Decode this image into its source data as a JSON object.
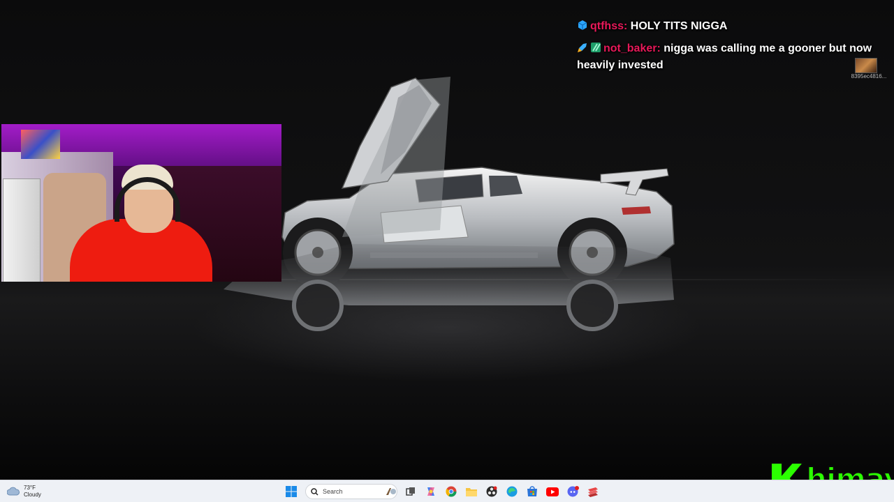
{
  "chat": {
    "messages": [
      {
        "username": "qtfhss:",
        "text": "HOLY TITS NIGGA"
      },
      {
        "username": "not_baker:",
        "text": "nigga was calling me a gooner but now heavily invested"
      }
    ],
    "emote_caption": "8395ec4816..."
  },
  "logo": {
    "text": "himay"
  },
  "taskbar": {
    "weather": {
      "temp": "73°F",
      "condition": "Cloudy"
    },
    "search": {
      "placeholder": "Search"
    },
    "icons": [
      "windows-start-icon",
      "search-icon",
      "task-view-icon",
      "copilot-icon",
      "chrome-icon",
      "file-explorer-icon",
      "obs-icon",
      "edge-icon",
      "microsoft-store-icon",
      "youtube-icon",
      "discord-icon",
      "stack-app-icon"
    ]
  },
  "colors": {
    "chat_username": "#e8195a",
    "logo_green": "#2bff00",
    "webcam_shirt": "#ee1c10",
    "taskbar_bg": "#eef1f6"
  }
}
